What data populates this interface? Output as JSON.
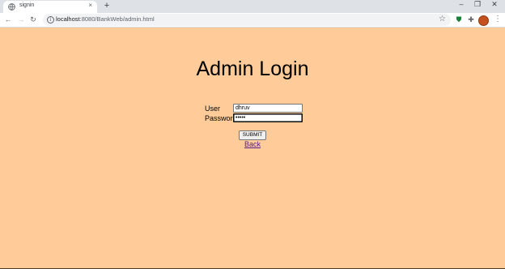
{
  "browser": {
    "tab_title": "signin",
    "tab_close": "×",
    "new_tab": "+",
    "window_controls": {
      "minimize": "–",
      "restore": "❐",
      "close": "✕"
    },
    "nav": {
      "back": "←",
      "forward": "→",
      "reload": "↻"
    },
    "url_host": "localhost",
    "url_rest": ":8080/BankWeb/admin.html",
    "icons": [
      "info-icon",
      "star-icon",
      "shield-extension-icon",
      "puzzle-extension-icon",
      "profile-avatar",
      "menu-dots-icon"
    ]
  },
  "page": {
    "background": "#ffcc99",
    "title": "Admin Login",
    "form": {
      "user_label": "User",
      "user_value": "dhruv",
      "password_label": "Password",
      "password_value": "•••••",
      "submit_label": "SUBMIT",
      "back_link": "Back"
    }
  }
}
